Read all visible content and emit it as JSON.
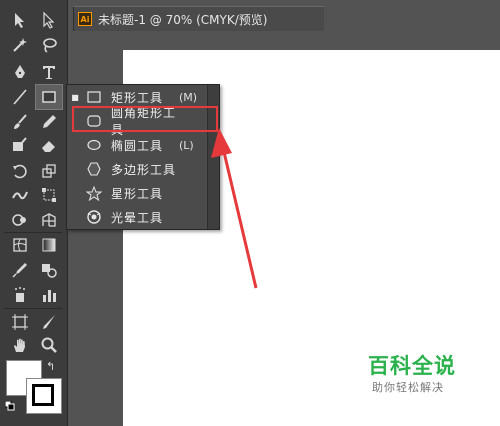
{
  "document": {
    "app_badge": "Ai",
    "tab_title": "未标题-1 @ 70% (CMYK/预览)",
    "close_glyph": "✕"
  },
  "tools": [
    {
      "name": "selection-tool",
      "icon": "arrow-solid"
    },
    {
      "name": "direct-selection-tool",
      "icon": "arrow-hollow"
    },
    {
      "name": "magic-wand-tool",
      "icon": "magic-wand"
    },
    {
      "name": "lasso-tool",
      "icon": "lasso"
    },
    {
      "name": "pen-tool",
      "icon": "pen"
    },
    {
      "name": "type-tool",
      "icon": "type"
    },
    {
      "name": "line-segment-tool",
      "icon": "line"
    },
    {
      "name": "rectangle-tool",
      "icon": "rectangle"
    },
    {
      "name": "paintbrush-tool",
      "icon": "brush"
    },
    {
      "name": "pencil-tool",
      "icon": "pencil"
    },
    {
      "name": "blob-brush-tool",
      "icon": "blob-brush"
    },
    {
      "name": "eraser-tool",
      "icon": "eraser"
    },
    {
      "name": "rotate-tool",
      "icon": "rotate"
    },
    {
      "name": "scale-tool",
      "icon": "scale"
    },
    {
      "name": "width-tool",
      "icon": "width"
    },
    {
      "name": "free-transform-tool",
      "icon": "free-transform"
    },
    {
      "name": "shape-builder-tool",
      "icon": "shape-builder"
    },
    {
      "name": "perspective-grid-tool",
      "icon": "perspective-grid"
    },
    {
      "name": "mesh-tool",
      "icon": "mesh"
    },
    {
      "name": "gradient-tool",
      "icon": "gradient"
    },
    {
      "name": "eyedropper-tool",
      "icon": "eyedropper"
    },
    {
      "name": "blend-tool",
      "icon": "blend"
    },
    {
      "name": "symbol-sprayer-tool",
      "icon": "symbol-sprayer"
    },
    {
      "name": "column-graph-tool",
      "icon": "column-graph"
    },
    {
      "name": "artboard-tool",
      "icon": "artboard"
    },
    {
      "name": "slice-tool",
      "icon": "slice"
    },
    {
      "name": "hand-tool",
      "icon": "hand"
    },
    {
      "name": "zoom-tool",
      "icon": "zoom"
    }
  ],
  "flyout": {
    "items": [
      {
        "label": "矩形工具",
        "shortcut": "(M)",
        "icon": "rectangle-icon",
        "bullet": "■"
      },
      {
        "label": "圆角矩形工具",
        "shortcut": "",
        "icon": "rounded-rectangle-icon",
        "bullet": ""
      },
      {
        "label": "椭圆工具",
        "shortcut": "(L)",
        "icon": "ellipse-icon",
        "bullet": ""
      },
      {
        "label": "多边形工具",
        "shortcut": "",
        "icon": "polygon-icon",
        "bullet": ""
      },
      {
        "label": "星形工具",
        "shortcut": "",
        "icon": "star-icon",
        "bullet": ""
      },
      {
        "label": "光晕工具",
        "shortcut": "",
        "icon": "flare-icon",
        "bullet": ""
      }
    ]
  },
  "annotation": {
    "color": "#e6393b"
  },
  "swatches": {
    "fill": "#ffffff",
    "stroke": "#000000",
    "swap_glyph": "↰"
  },
  "watermark": {
    "title": "百科全说",
    "subtitle": "助你轻松解决",
    "color": "#2bb24c"
  }
}
